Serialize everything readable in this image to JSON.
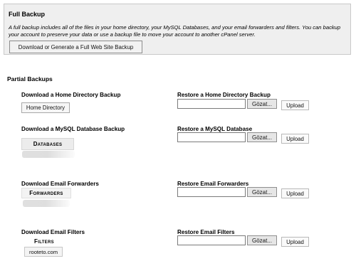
{
  "full_backup": {
    "title": "Full Backup",
    "description": "A full backup includes all of the files in your home directory, your MySQL Databases, and your email forwarders and filters. You can backup your account to preserve your data or use a backup file to move your account to another cPanel server.",
    "button_label": "Download or Generate a Full Web Site Backup"
  },
  "partial_backups": {
    "title": "Partial Backups",
    "rows": [
      {
        "download_label": "Download a Home Directory Backup",
        "download_button": "Home Directory",
        "restore_label": "Restore a Home Directory Backup",
        "browse_label": "Gözat...",
        "upload_label": "Upload"
      },
      {
        "download_label": "Download a MySQL Database Backup",
        "download_button": "Databases",
        "restore_label": "Restore a MySQL Database",
        "browse_label": "Gözat...",
        "upload_label": "Upload"
      },
      {
        "download_label": "Download Email Forwarders",
        "download_button": "Forwarders",
        "restore_label": "Restore Email Forwarders",
        "browse_label": "Gözat...",
        "upload_label": "Upload"
      },
      {
        "download_label": "Download Email Filters",
        "download_button": "Filters",
        "download_sub": "rooteto.com",
        "restore_label": "Restore Email Filters",
        "browse_label": "Gözat...",
        "upload_label": "Upload"
      }
    ]
  }
}
